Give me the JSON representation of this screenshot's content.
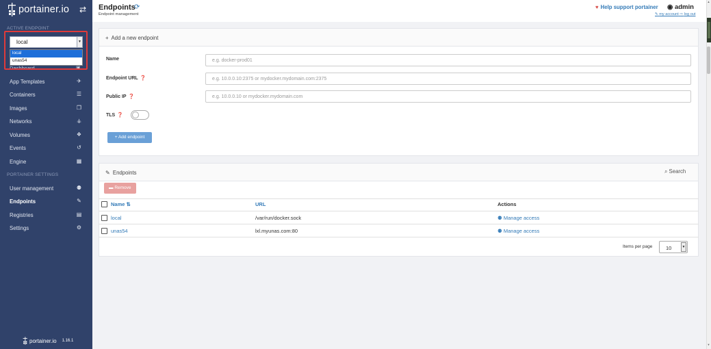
{
  "sidebar": {
    "brand": "portainer.io",
    "active_endpoint_title": "ACTIVE ENDPOINT",
    "endpoint_select": {
      "value": "local",
      "options": [
        "local",
        "unas54"
      ]
    },
    "dashboard_peek": "Dashboard",
    "items": [
      {
        "label": "App Templates",
        "icon": "rocket-icon",
        "glyph": "✈"
      },
      {
        "label": "Containers",
        "icon": "list-icon",
        "glyph": "☰"
      },
      {
        "label": "Images",
        "icon": "clone-icon",
        "glyph": "❐"
      },
      {
        "label": "Networks",
        "icon": "sitemap-icon",
        "glyph": "⚶"
      },
      {
        "label": "Volumes",
        "icon": "cubes-icon",
        "glyph": "❖"
      },
      {
        "label": "Events",
        "icon": "history-icon",
        "glyph": "↺"
      },
      {
        "label": "Engine",
        "icon": "th-icon",
        "glyph": "▦"
      }
    ],
    "settings_title": "PORTAINER SETTINGS",
    "settings_items": [
      {
        "label": "User management",
        "icon": "users-icon",
        "glyph": "👥"
      },
      {
        "label": "Endpoints",
        "icon": "plug-icon",
        "glyph": "✎"
      },
      {
        "label": "Registries",
        "icon": "database-icon",
        "glyph": "▤"
      },
      {
        "label": "Settings",
        "icon": "cogs-icon",
        "glyph": "⚙"
      }
    ],
    "footer_brand": "portainer.io",
    "version": "1.16.1"
  },
  "header": {
    "title": "Endpoints",
    "subtitle": "Endpoint management",
    "help_link": "Help support portainer",
    "user": "admin",
    "my_account": "my account",
    "log_out": "log out"
  },
  "add_panel": {
    "title": "Add a new endpoint",
    "name_label": "Name",
    "name_placeholder": "e.g. docker-prod01",
    "url_label": "Endpoint URL",
    "url_placeholder": "e.g. 10.0.0.10:2375 or mydocker.mydomain.com:2375",
    "public_ip_label": "Public IP",
    "public_ip_placeholder": "e.g. 10.0.0.10 or mydocker.mydomain.com",
    "tls_label": "TLS",
    "add_button": "+ Add endpoint"
  },
  "endpoints_panel": {
    "title": "Endpoints",
    "search": "Search",
    "remove_button": "Remove",
    "columns": {
      "name": "Name",
      "url": "URL",
      "actions": "Actions"
    },
    "rows": [
      {
        "name": "local",
        "url": "/var/run/docker.sock",
        "action": "Manage access"
      },
      {
        "name": "unas54",
        "url": "lxl.myunas.com:80",
        "action": "Manage access"
      }
    ],
    "items_per_page_label": "Items per page",
    "items_per_page": "10"
  },
  "colors": {
    "sidebar_bg": "#30426a",
    "link": "#337ab7",
    "highlight_border": "#e03a3a",
    "remove_button": "#e8a19f",
    "add_button": "#6aa0d7"
  }
}
